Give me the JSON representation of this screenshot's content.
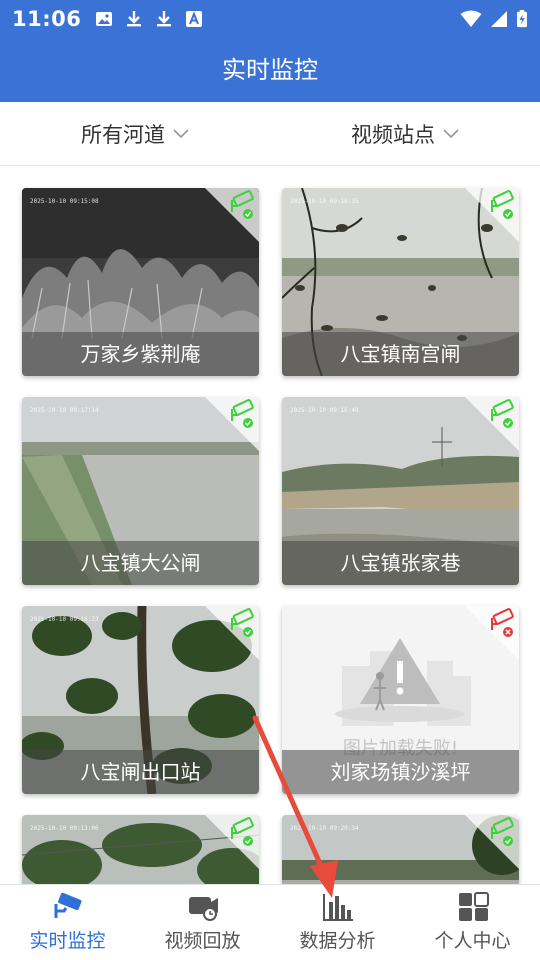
{
  "status_bar": {
    "time": "11:06"
  },
  "header": {
    "title": "实时监控"
  },
  "filters": [
    {
      "label": "所有河道"
    },
    {
      "label": "视频站点"
    }
  ],
  "cameras": [
    {
      "name": "万家乡紫荆庵",
      "timestamp": "2025-10-10 09:15:08",
      "online": true
    },
    {
      "name": "八宝镇南宫闸",
      "timestamp": "2025-10-10 09:16:35",
      "online": true
    },
    {
      "name": "八宝镇大公闸",
      "timestamp": "2025-10-10 09:17:14",
      "online": true
    },
    {
      "name": "八宝镇张家巷",
      "timestamp": "2025-10-10 09:16:48",
      "online": true
    },
    {
      "name": "八宝闸出口站",
      "timestamp": "2025-10-10 09:16:23",
      "online": true
    },
    {
      "name": "刘家场镇沙溪坪",
      "online": false,
      "failed_text": "图片加载失败!"
    },
    {
      "timestamp": "2025-10-10 09:13:06",
      "online": true
    },
    {
      "timestamp": "2025-10-10 09:20:34",
      "online": true
    }
  ],
  "bottom_nav": [
    {
      "label": "实时监控",
      "active": true
    },
    {
      "label": "视频回放",
      "active": false
    },
    {
      "label": "数据分析",
      "active": false
    },
    {
      "label": "个人中心",
      "active": false
    }
  ],
  "colors": {
    "primary": "#3a72d6",
    "online": "#3ed13a",
    "offline": "#e53935",
    "annotation": "#e84b3c"
  }
}
